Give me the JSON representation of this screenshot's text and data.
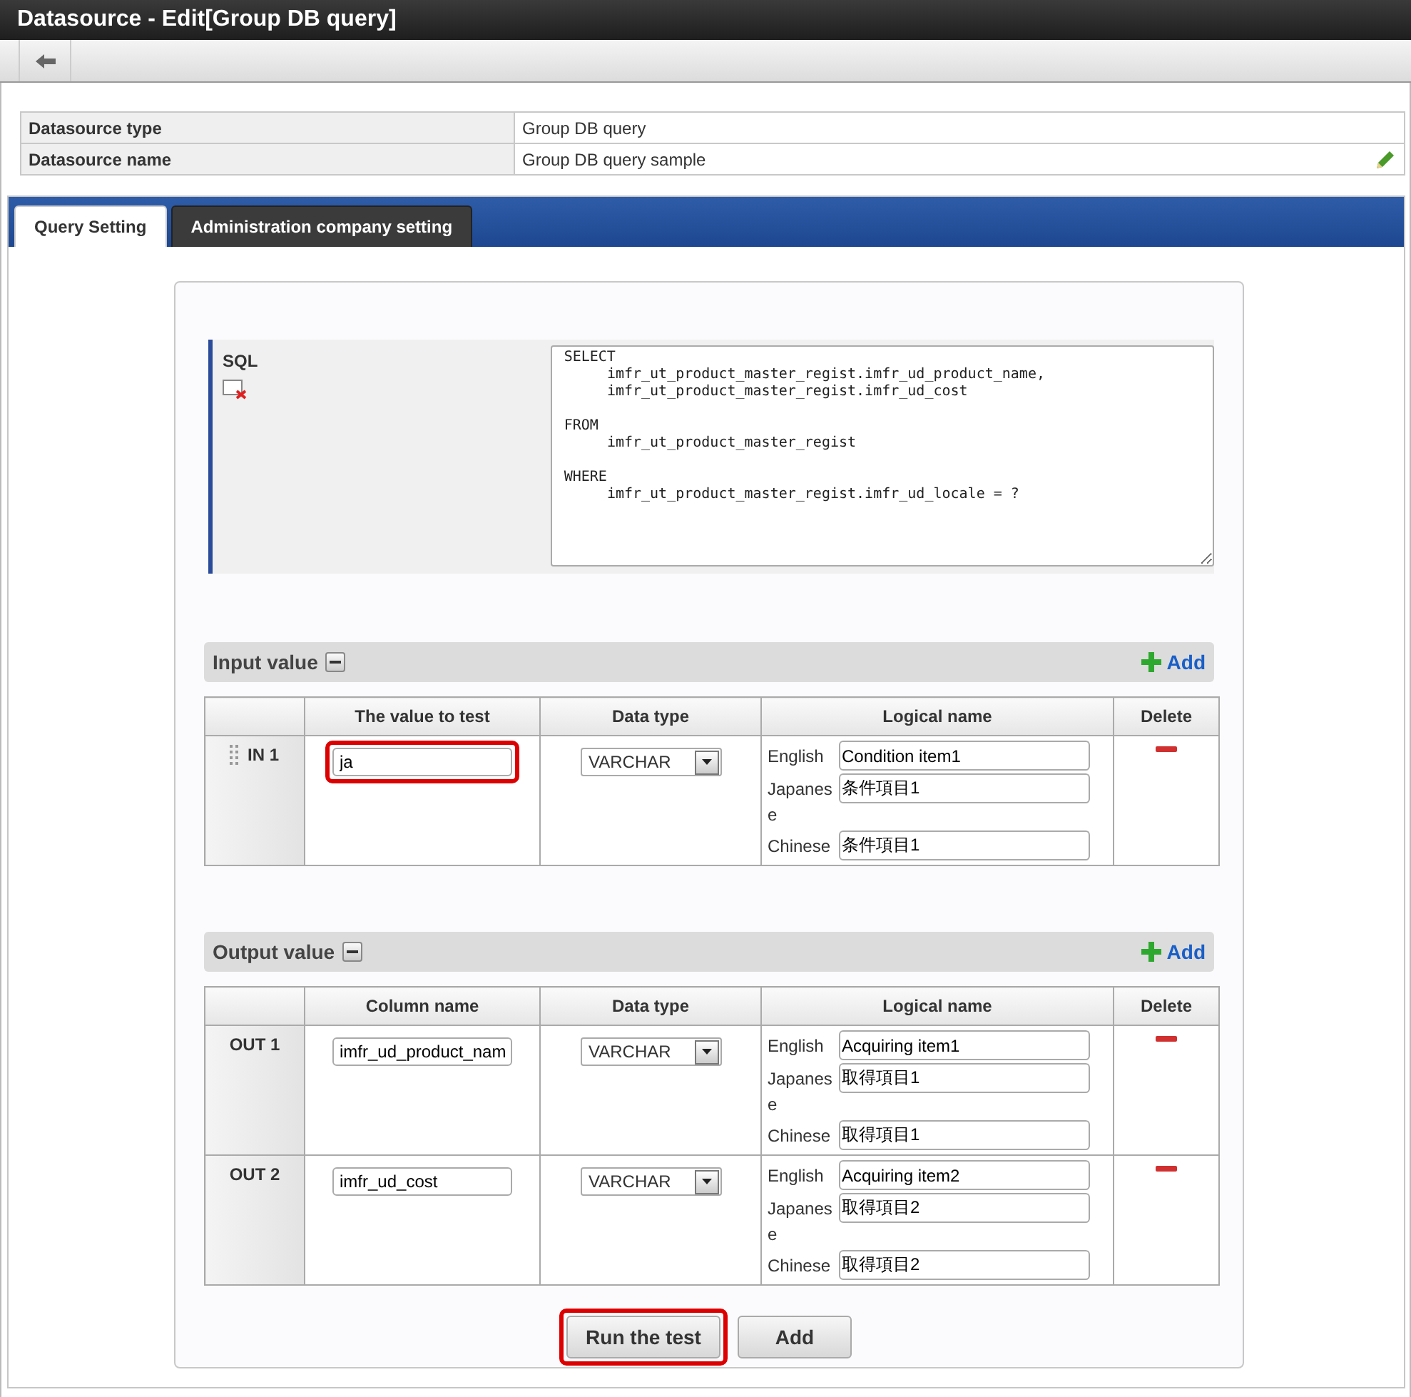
{
  "window": {
    "title": "Datasource - Edit[Group DB query]"
  },
  "info": [
    {
      "label": "Datasource type",
      "value": "Group DB query",
      "editable": false
    },
    {
      "label": "Datasource name",
      "value": "Group DB query sample",
      "editable": true
    }
  ],
  "tabs": [
    {
      "label": "Query Setting",
      "selected": true
    },
    {
      "label": "Administration company setting",
      "selected": false
    }
  ],
  "sql": {
    "label": "SQL",
    "value": "SELECT\n     imfr_ut_product_master_regist.imfr_ud_product_name,\n     imfr_ut_product_master_regist.imfr_ud_cost\n\nFROM\n     imfr_ut_product_master_regist\n\nWHERE\n     imfr_ut_product_master_regist.imfr_ud_locale = ?"
  },
  "sections": [
    {
      "title": "Input value",
      "add_label": "Add",
      "columns": [
        "",
        "The value to test",
        "Data type",
        "Logical name",
        "Delete"
      ],
      "draggable": true,
      "rows": [
        {
          "label": "IN 1",
          "value": "ja",
          "highlighted": true,
          "data_type": "VARCHAR",
          "names": [
            {
              "lang": "English",
              "value": "Condition item1"
            },
            {
              "lang": "Japanese",
              "value": "条件項目1"
            },
            {
              "lang": "Chinese",
              "value": "条件項目1"
            }
          ]
        }
      ]
    },
    {
      "title": "Output value",
      "add_label": "Add",
      "columns": [
        "",
        "Column name",
        "Data type",
        "Logical name",
        "Delete"
      ],
      "draggable": false,
      "rows": [
        {
          "label": "OUT 1",
          "value": "imfr_ud_product_nam",
          "highlighted": false,
          "data_type": "VARCHAR",
          "names": [
            {
              "lang": "English",
              "value": "Acquiring item1"
            },
            {
              "lang": "Japanese",
              "value": "取得項目1"
            },
            {
              "lang": "Chinese",
              "value": "取得項目1"
            }
          ]
        },
        {
          "label": "OUT 2",
          "value": "imfr_ud_cost",
          "highlighted": false,
          "data_type": "VARCHAR",
          "names": [
            {
              "lang": "English",
              "value": "Acquiring item2"
            },
            {
              "lang": "Japanese",
              "value": "取得項目2"
            },
            {
              "lang": "Chinese",
              "value": "取得項目2"
            }
          ]
        }
      ]
    }
  ],
  "buttons": [
    {
      "label": "Run the test",
      "highlighted": true
    },
    {
      "label": "Add",
      "highlighted": false
    }
  ]
}
